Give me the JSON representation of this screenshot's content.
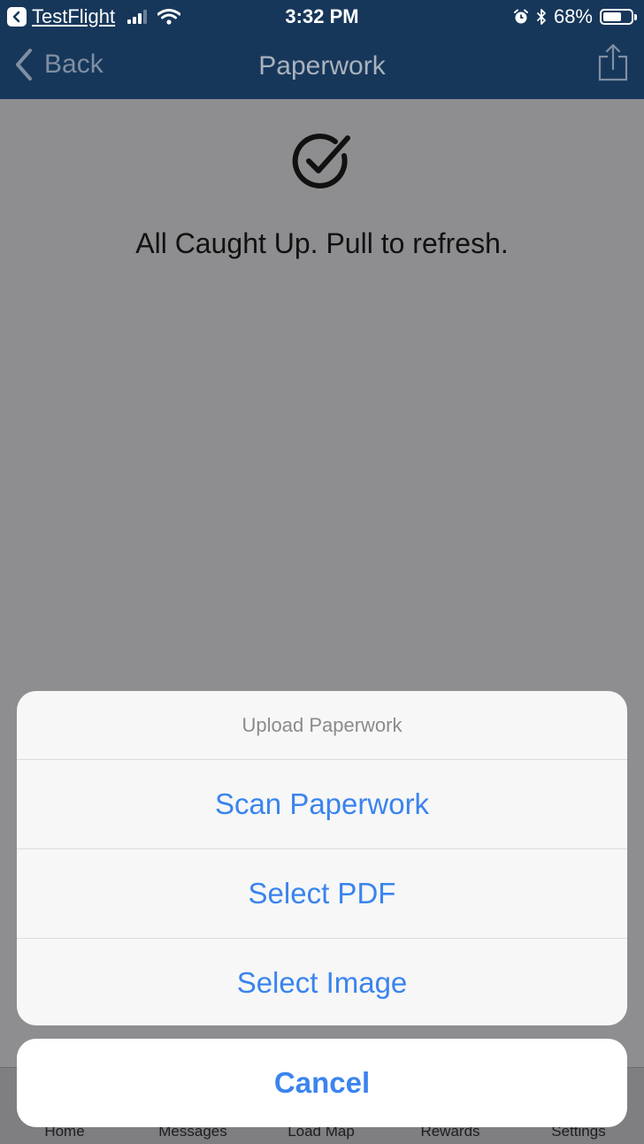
{
  "status_bar": {
    "back_app": "TestFlight",
    "time": "3:32 PM",
    "battery_percent": "68%",
    "battery_level": 0.68,
    "signal_bars_active": 3,
    "signal_bars_total": 4
  },
  "nav": {
    "back_label": "Back",
    "title": "Paperwork"
  },
  "content": {
    "empty_message": "All Caught Up. Pull to refresh."
  },
  "tabbar": {
    "tabs": [
      "Home",
      "Messages",
      "Load Map",
      "Rewards",
      "Settings"
    ]
  },
  "action_sheet": {
    "title": "Upload Paperwork",
    "actions": [
      "Scan Paperwork",
      "Select PDF",
      "Select Image"
    ],
    "cancel_label": "Cancel"
  },
  "colors": {
    "nav_bar": "#17375a",
    "dim_overlay": "#8e8e90",
    "action_blue": "#3a84ee",
    "sheet_bg": "#f7f7f7"
  }
}
